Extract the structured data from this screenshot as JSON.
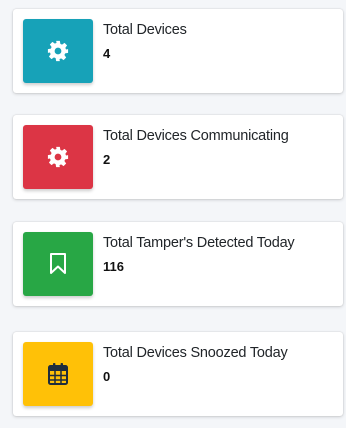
{
  "cards": [
    {
      "title": "Total Devices",
      "value": "4",
      "icon": "gear-icon",
      "color": "#17a2b8"
    },
    {
      "title": "Total Devices Communicating",
      "value": "2",
      "icon": "gear-icon",
      "color": "#dc3545"
    },
    {
      "title": "Total Tamper's Detected Today",
      "value": "116",
      "icon": "bookmark-icon",
      "color": "#28a745"
    },
    {
      "title": "Total Devices Snoozed Today",
      "value": "0",
      "icon": "calendar-icon",
      "color": "#ffc107"
    }
  ]
}
